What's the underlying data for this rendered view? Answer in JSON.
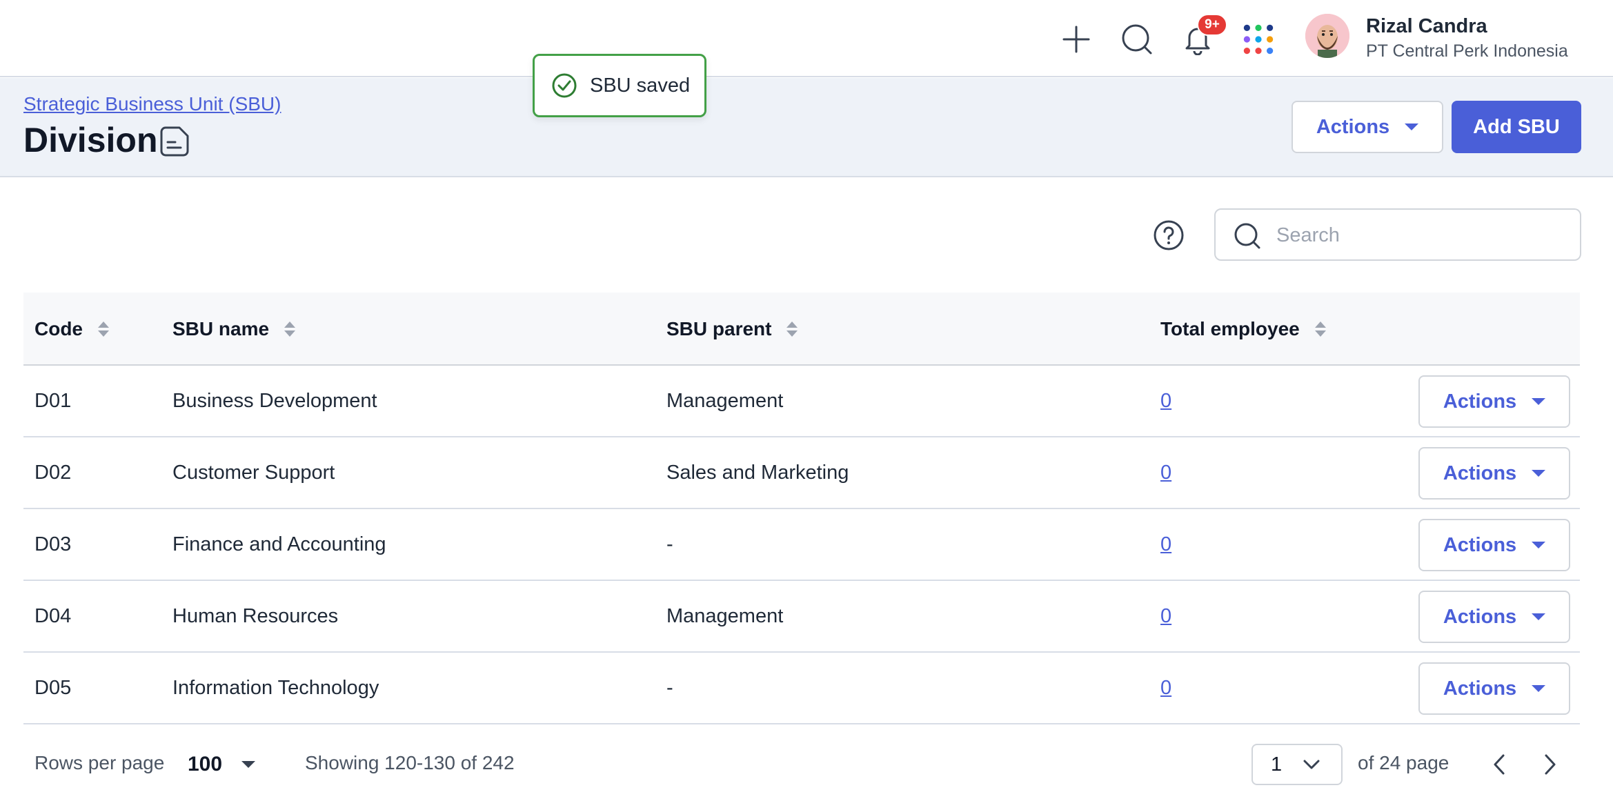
{
  "topbar": {
    "notification_count": "9+",
    "user": {
      "name": "Rizal Candra",
      "company": "PT Central Perk Indonesia"
    },
    "app_dot_colors": [
      "#1e3a8a",
      "#22c55e",
      "#1e3a8a",
      "#8b5cf6",
      "#0ea5e9",
      "#f59e0b",
      "#ef4444",
      "#ef4444",
      "#3b82f6"
    ]
  },
  "toast": {
    "message": "SBU saved"
  },
  "header": {
    "breadcrumb": "Strategic Business Unit (SBU)",
    "title": "Division",
    "actions_label": "Actions",
    "add_label": "Add SBU"
  },
  "search": {
    "placeholder": "Search"
  },
  "table": {
    "columns": [
      "Code",
      "SBU name",
      "SBU parent",
      "Total employee"
    ],
    "rows": [
      {
        "code": "D01",
        "name": "Business Development",
        "parent": "Management",
        "total": "0",
        "action": "Actions"
      },
      {
        "code": "D02",
        "name": "Customer Support",
        "parent": "Sales and Marketing",
        "total": "0",
        "action": "Actions"
      },
      {
        "code": "D03",
        "name": "Finance and Accounting",
        "parent": "-",
        "total": "0",
        "action": "Actions"
      },
      {
        "code": "D04",
        "name": "Human Resources",
        "parent": "Management",
        "total": "0",
        "action": "Actions"
      },
      {
        "code": "D05",
        "name": "Information Technology",
        "parent": "-",
        "total": "0",
        "action": "Actions"
      }
    ]
  },
  "footer": {
    "rows_per_page_label": "Rows per page",
    "rows_per_page_value": "100",
    "showing": "Showing 120-130 of 242",
    "current_page": "1",
    "of_pages": "of 24 page"
  },
  "colors": {
    "accent": "#4a5fd8",
    "toast_border": "#43a047",
    "badge": "#e53935",
    "header_bg": "#eef2f8"
  }
}
